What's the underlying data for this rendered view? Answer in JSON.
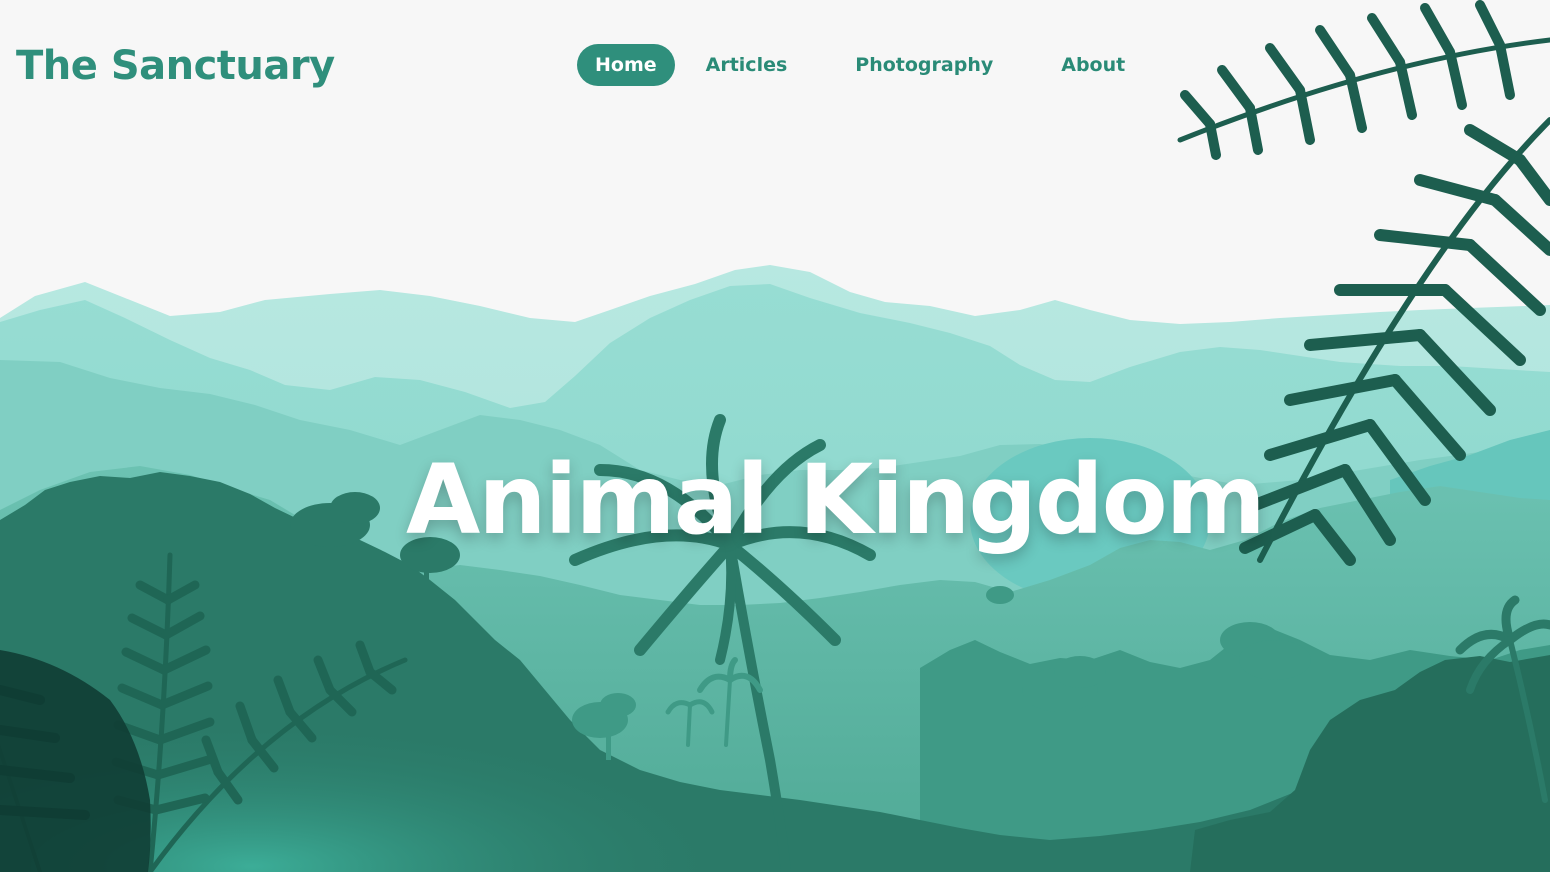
{
  "site": {
    "logo": "The Sanctuary"
  },
  "nav": {
    "items": [
      {
        "label": "Home",
        "active": true
      },
      {
        "label": "Articles",
        "active": false
      },
      {
        "label": "Photography",
        "active": false
      },
      {
        "label": "About",
        "active": false
      }
    ]
  },
  "hero": {
    "title": "Animal Kingdom",
    "scene": [
      "layered-mountains",
      "palm-tree-silhouettes",
      "fern-fronds"
    ]
  },
  "colors": {
    "page_background": "#f7f7f7",
    "brand_teal": "#2f8f7c",
    "nav_text": "#2a8b77",
    "hero_title": "#ffffff",
    "mountain_far": "#b3e6df",
    "mountain_mid": "#95ddd3",
    "hills": "#5fb8a6",
    "jungle_dark": "#2b7a68",
    "fern_dark": "#1d5e4f"
  }
}
